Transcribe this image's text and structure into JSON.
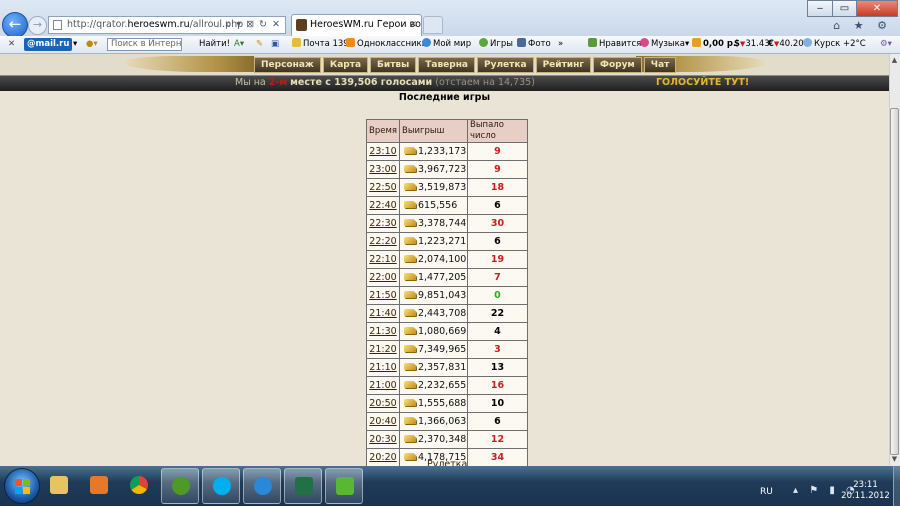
{
  "browser": {
    "address_prefix": "http://qrator.",
    "address_domain": "heroeswm.ru",
    "address_path": "/allroul.php",
    "address_tools": "⌕ ▾ ⊠ ↻ ✕",
    "tab_title": "HeroesWM.ru Герои войн...",
    "tab_close": "✕",
    "window_min": "‒",
    "window_max": "▭",
    "window_close": "✕",
    "right_icons": "⌂ ★ ⚙"
  },
  "toolbar": {
    "close": "✕",
    "mail_logo": "@mail.ru",
    "mail_arrow": "▾",
    "search_placeholder": "Поиск в Интернете",
    "find_button": "Найти!",
    "items": [
      "Почта 139",
      "Одноклассники",
      "Мой мир",
      "Игры",
      "Фото"
    ],
    "more": "»",
    "right_items": [
      "Нравится",
      "Музыка▾",
      "0,00 р.",
      "31.43",
      "40.20",
      "Курск +2°C"
    ]
  },
  "menu": [
    "Персонаж",
    "Карта",
    "Битвы",
    "Таверна",
    "Рулетка",
    "Рейтинг",
    "Форум",
    "Чат"
  ],
  "vote_banner": {
    "prefix": "Мы на",
    "rank": "2-м",
    "middle": "месте с 139,506 голосами",
    "behind": "(отстаем на 14,735)",
    "link": "ГОЛОСУЙТЕ ТУТ!"
  },
  "page_title": "Последние игры",
  "table": {
    "headers": [
      "Время",
      "Выигрыш",
      "Выпало число"
    ],
    "rows": [
      {
        "time": "23:10",
        "win": "1,233,173",
        "num": "9"
      },
      {
        "time": "23:00",
        "win": "3,967,723",
        "num": "9"
      },
      {
        "time": "22:50",
        "win": "3,519,873",
        "num": "18"
      },
      {
        "time": "22:40",
        "win": "615,556",
        "num": "6"
      },
      {
        "time": "22:30",
        "win": "3,378,744",
        "num": "30"
      },
      {
        "time": "22:20",
        "win": "1,223,271",
        "num": "6"
      },
      {
        "time": "22:10",
        "win": "2,074,100",
        "num": "19"
      },
      {
        "time": "22:00",
        "win": "1,477,205",
        "num": "7"
      },
      {
        "time": "21:50",
        "win": "9,851,043",
        "num": "0"
      },
      {
        "time": "21:40",
        "win": "2,443,708",
        "num": "22"
      },
      {
        "time": "21:30",
        "win": "1,080,669",
        "num": "4"
      },
      {
        "time": "21:20",
        "win": "7,349,965",
        "num": "3"
      },
      {
        "time": "21:10",
        "win": "2,357,831",
        "num": "13"
      },
      {
        "time": "21:00",
        "win": "2,232,655",
        "num": "16"
      },
      {
        "time": "20:50",
        "win": "1,555,688",
        "num": "10"
      },
      {
        "time": "20:40",
        "win": "1,366,063",
        "num": "6"
      },
      {
        "time": "20:30",
        "win": "2,370,348",
        "num": "12"
      },
      {
        "time": "20:20",
        "win": "4,178,715",
        "num": "34"
      }
    ]
  },
  "footer_link": "Рулетка",
  "number_colors": {
    "red": "#c81e1e",
    "black": "#000000",
    "green": "#22b022"
  },
  "taskbar": {
    "apps": [
      "windows-explorer",
      "media-player",
      "chrome",
      "utorrent",
      "skype",
      "internet-explorer",
      "excel",
      "app-green"
    ],
    "lang": "RU",
    "tray_icons": "▴ ⚑ ▮ ◔",
    "time": "23:11",
    "date": "20.11.2012"
  },
  "scrollbar": {
    "up": "▲",
    "down": "▼"
  }
}
